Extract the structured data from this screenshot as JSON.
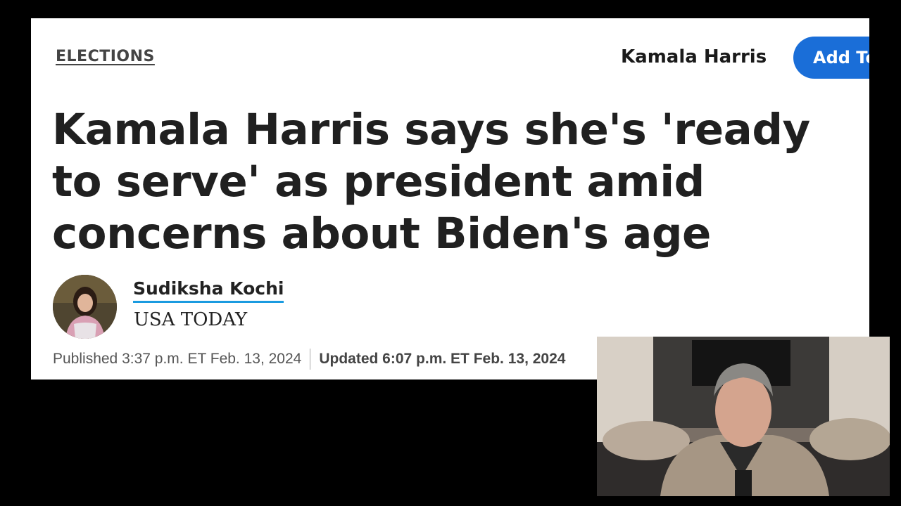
{
  "topic": {
    "label": "ELECTIONS"
  },
  "tag": {
    "name": "Kamala Harris",
    "add_button_label": "Add Topic"
  },
  "headline": "Kamala Harris says she's 'ready to serve' as president amid concerns about Biden's age",
  "author": {
    "name": "Sudiksha Kochi",
    "publication": "USA TODAY"
  },
  "dates": {
    "published": "Published 3:37 p.m. ET Feb. 13, 2024",
    "updated": "Updated 6:07 p.m. ET Feb. 13, 2024"
  },
  "colors": {
    "accent": "#1a6ed8",
    "author_underline": "#1a9be0",
    "headline": "#202020"
  }
}
